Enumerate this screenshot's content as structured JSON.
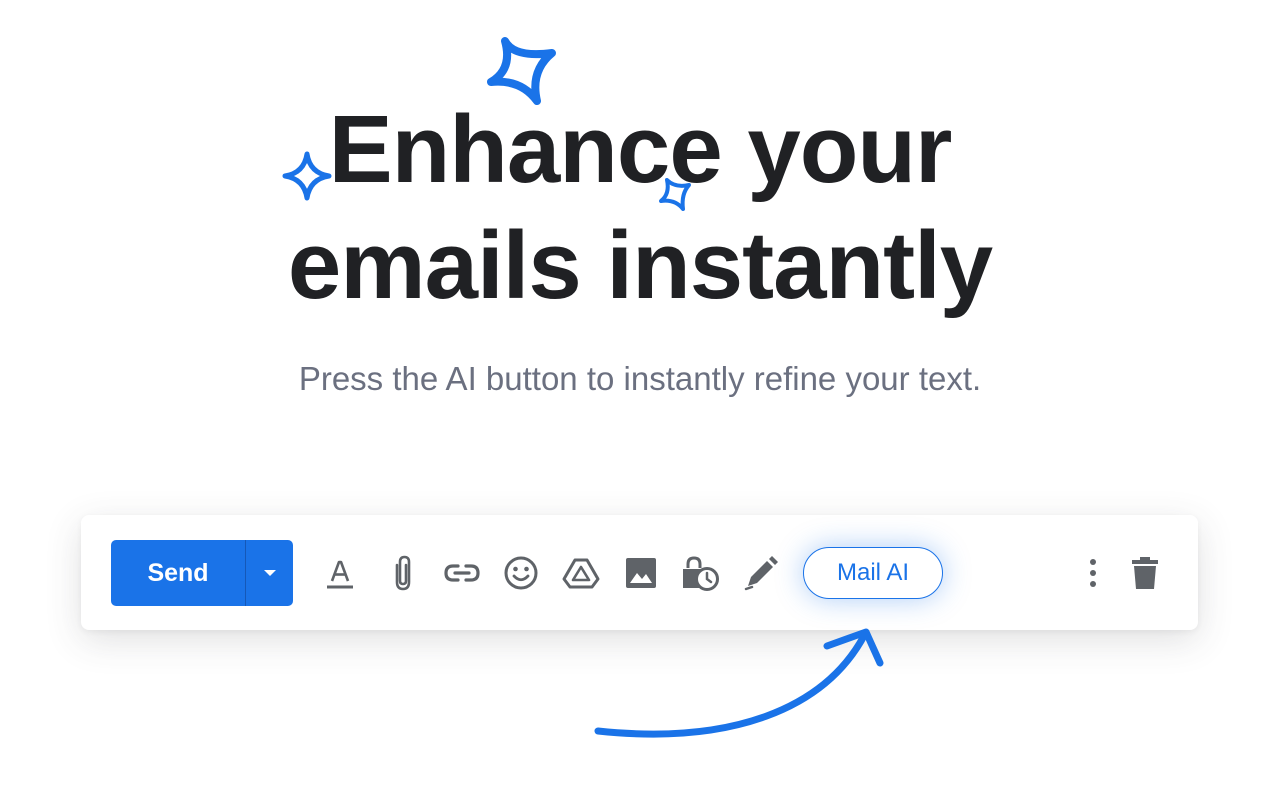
{
  "hero": {
    "title_line1": "Enhance your",
    "title_line2": "emails instantly",
    "subtitle": "Press the AI button to instantly refine your text."
  },
  "toolbar": {
    "send_label": "Send",
    "mail_ai_label": "Mail AI",
    "icons": [
      "send-options-chevron-icon",
      "text-format-icon",
      "attachment-icon",
      "link-icon",
      "emoji-icon",
      "drive-icon",
      "image-icon",
      "confidential-mode-icon",
      "signature-pen-icon",
      "more-options-icon",
      "trash-icon"
    ]
  },
  "colors": {
    "accent": "#1a73e8",
    "heading": "#202124",
    "subtitle": "#6b7080",
    "icon": "#5f6368"
  }
}
